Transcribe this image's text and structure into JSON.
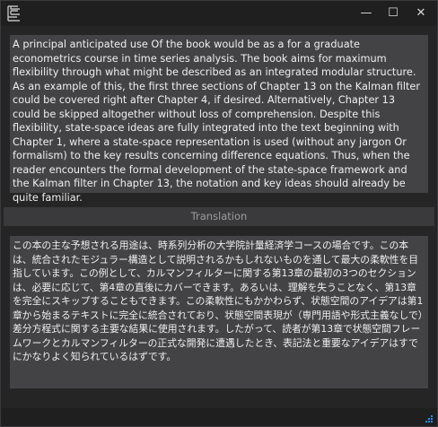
{
  "window": {
    "app_icon": "app-logo-icon",
    "controls": {
      "minimize_icon": "minimize-icon",
      "minimize_glyph": "—",
      "maximize_icon": "maximize-icon",
      "maximize_glyph": "☐",
      "close_icon": "close-icon",
      "close_glyph": "✕"
    }
  },
  "source": {
    "text": "A principal anticipated use Of the book would be as a for a graduate econometrics course in time series analysis. The book aims for maximum flexibility through what might be described as an integrated modular structure. As an example of this, the first three sections of Chapter 13 on the Kalman filter could be covered right after Chapter 4, if desired. Alternatively, Chapter 13 could be skipped altogether without loss of comprehension. Despite this flexibility, state-space ideas are fully integrated into the text beginning with Chapter 1, where a state-space representation is used (without any jargon Or formalism) to the key results concerning difference equations. Thus, when the reader encounters the formal development of the state-space framework and the Kalman filter in Chapter 13, the notation and key ideas should already be quite familiar."
  },
  "divider": {
    "label": "Translation"
  },
  "translation": {
    "text": "この本の主な予想される用途は、時系列分析の大学院計量経済学コースの場合です。この本は、統合されたモジュラー構造として説明されるかもしれないものを通して最大の柔軟性を目指しています。この例として、カルマンフィルターに関する第13章の最初の3つのセクションは、必要に応じて、第4章の直後にカバーできます。あるいは、理解を失うことなく、第13章を完全にスキップすることもできます。この柔軟性にもかかわらず、状態空間のアイデアは第1章から始まるテキストに完全に統合されており、状態空間表現が（専門用語や形式主義なしで）差分方程式に関する主要な結果に使用されます。したがって、読者が第13章で状態空間フレームワークとカルマンフィルターの正式な開発に遭遇したとき、表記法と重要なアイデアはすでにかなりよく知られているはずです。"
  },
  "colors": {
    "window_bg": "#252526",
    "panel_bg": "#434346",
    "text": "#f0f0f0",
    "divider_text": "#9c9c9c",
    "accent": "#1e8fff"
  }
}
